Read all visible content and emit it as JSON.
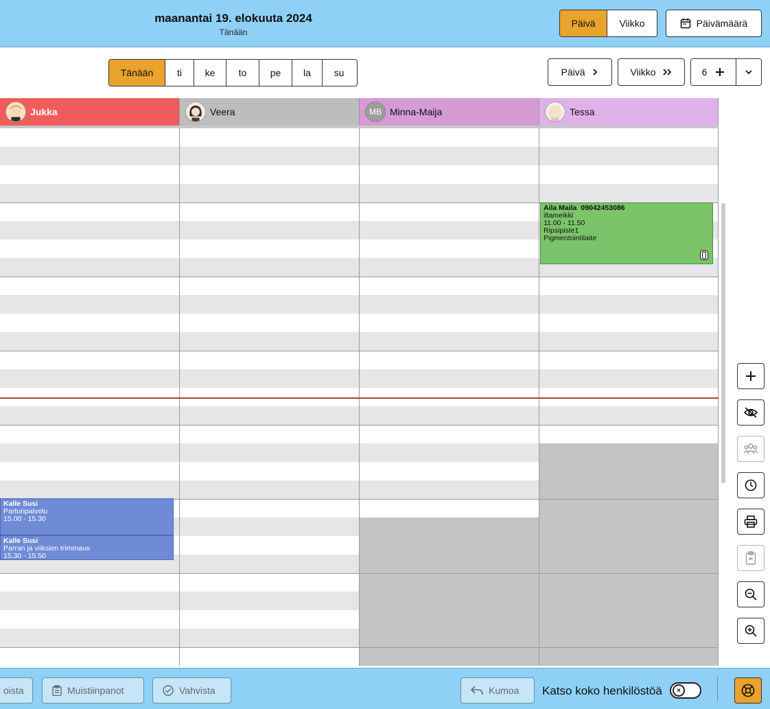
{
  "header": {
    "date_title": "maanantai 19. elokuuta 2024",
    "subtitle": "Tänään",
    "view_day": "Päivä",
    "view_week": "Viikko",
    "date_picker": "Päivämäärä"
  },
  "toolbar": {
    "days": [
      "Tänään",
      "ti",
      "ke",
      "to",
      "pe",
      "la",
      "su"
    ],
    "next_day": "Päivä",
    "next_week": "Viikko",
    "staff_count": "6"
  },
  "staff": [
    {
      "name": "Jukka",
      "color": "#f05b5b",
      "avatar": "avatar-illustration"
    },
    {
      "name": "Veera",
      "color": "#bdbdbd",
      "avatar": "avatar-illustration"
    },
    {
      "name": "Minna-Maija",
      "color": "#d49bd4",
      "initials": "MB"
    },
    {
      "name": "Tessa",
      "color": "#e0b1e8",
      "avatar": "avatar-illustration"
    }
  ],
  "appointments": [
    {
      "name": "Aila Maila",
      "phone": "09042453086",
      "service": "iltameikki",
      "time": "11.00 - 11.50",
      "location": "Ripsipiste1",
      "extra": "Pigmentointilaite",
      "color": "#7cc46a"
    },
    {
      "name": "Kalle Susi",
      "service": "Parturipalvelu",
      "time": "15.00 - 15.30",
      "color": "#6f8bd6"
    },
    {
      "name": "Kalle Susi",
      "service": "Parran ja viiksien trimmaus",
      "time": "15.30 - 15.50",
      "color": "#6f8bd6"
    }
  ],
  "footer": {
    "partial_button": "oista",
    "notes_button": "Muistiinpanot",
    "confirm_button": "Vahvista",
    "undo_button": "Kumoa",
    "toggle_label": "Katso koko henkilöstöä"
  },
  "colors": {
    "header_bg": "#8fd0f7",
    "accent": "#eaa32c",
    "stripe": "#e6e6e9",
    "unavailable": "#c4c4c4",
    "now_line": "#b0412e"
  }
}
